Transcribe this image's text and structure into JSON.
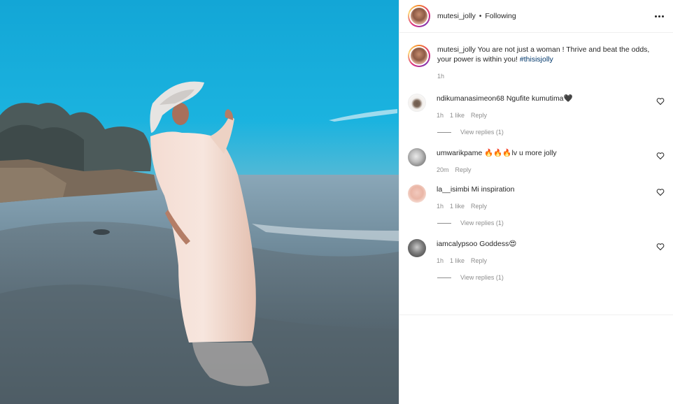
{
  "post": {
    "author": "mutesi_jolly",
    "separator": "•",
    "follow_state": "Following"
  },
  "caption": {
    "username": "mutesi_jolly",
    "text": "You are not just a woman ! Thrive and beat the odds, your power is within you!",
    "hashtag": "#thisisjolly",
    "time": "1h"
  },
  "comments": [
    {
      "username": "ndikumanasimeon68",
      "text": "Ngufite kumutima🖤",
      "time": "1h",
      "likes": "1 like",
      "reply": "Reply",
      "view_replies": "View replies (1)"
    },
    {
      "username": "umwarikpame",
      "text": "🔥🔥🔥lv u more jolly",
      "time": "20m",
      "likes": "",
      "reply": "Reply",
      "view_replies": ""
    },
    {
      "username": "la__isimbi",
      "text": "Mi inspiration",
      "time": "1h",
      "likes": "1 like",
      "reply": "Reply",
      "view_replies": "View replies (1)"
    },
    {
      "username": "iamcalypsoo",
      "text": "Goddess😍",
      "time": "1h",
      "likes": "1 like",
      "reply": "Reply",
      "view_replies": "View replies (1)"
    }
  ],
  "icons": {
    "more": "more-options-icon",
    "like": "heart-outline-icon"
  },
  "colors": {
    "hashtag": "#00376b",
    "secondary_text": "#8e8e8e",
    "primary_text": "#262626"
  }
}
